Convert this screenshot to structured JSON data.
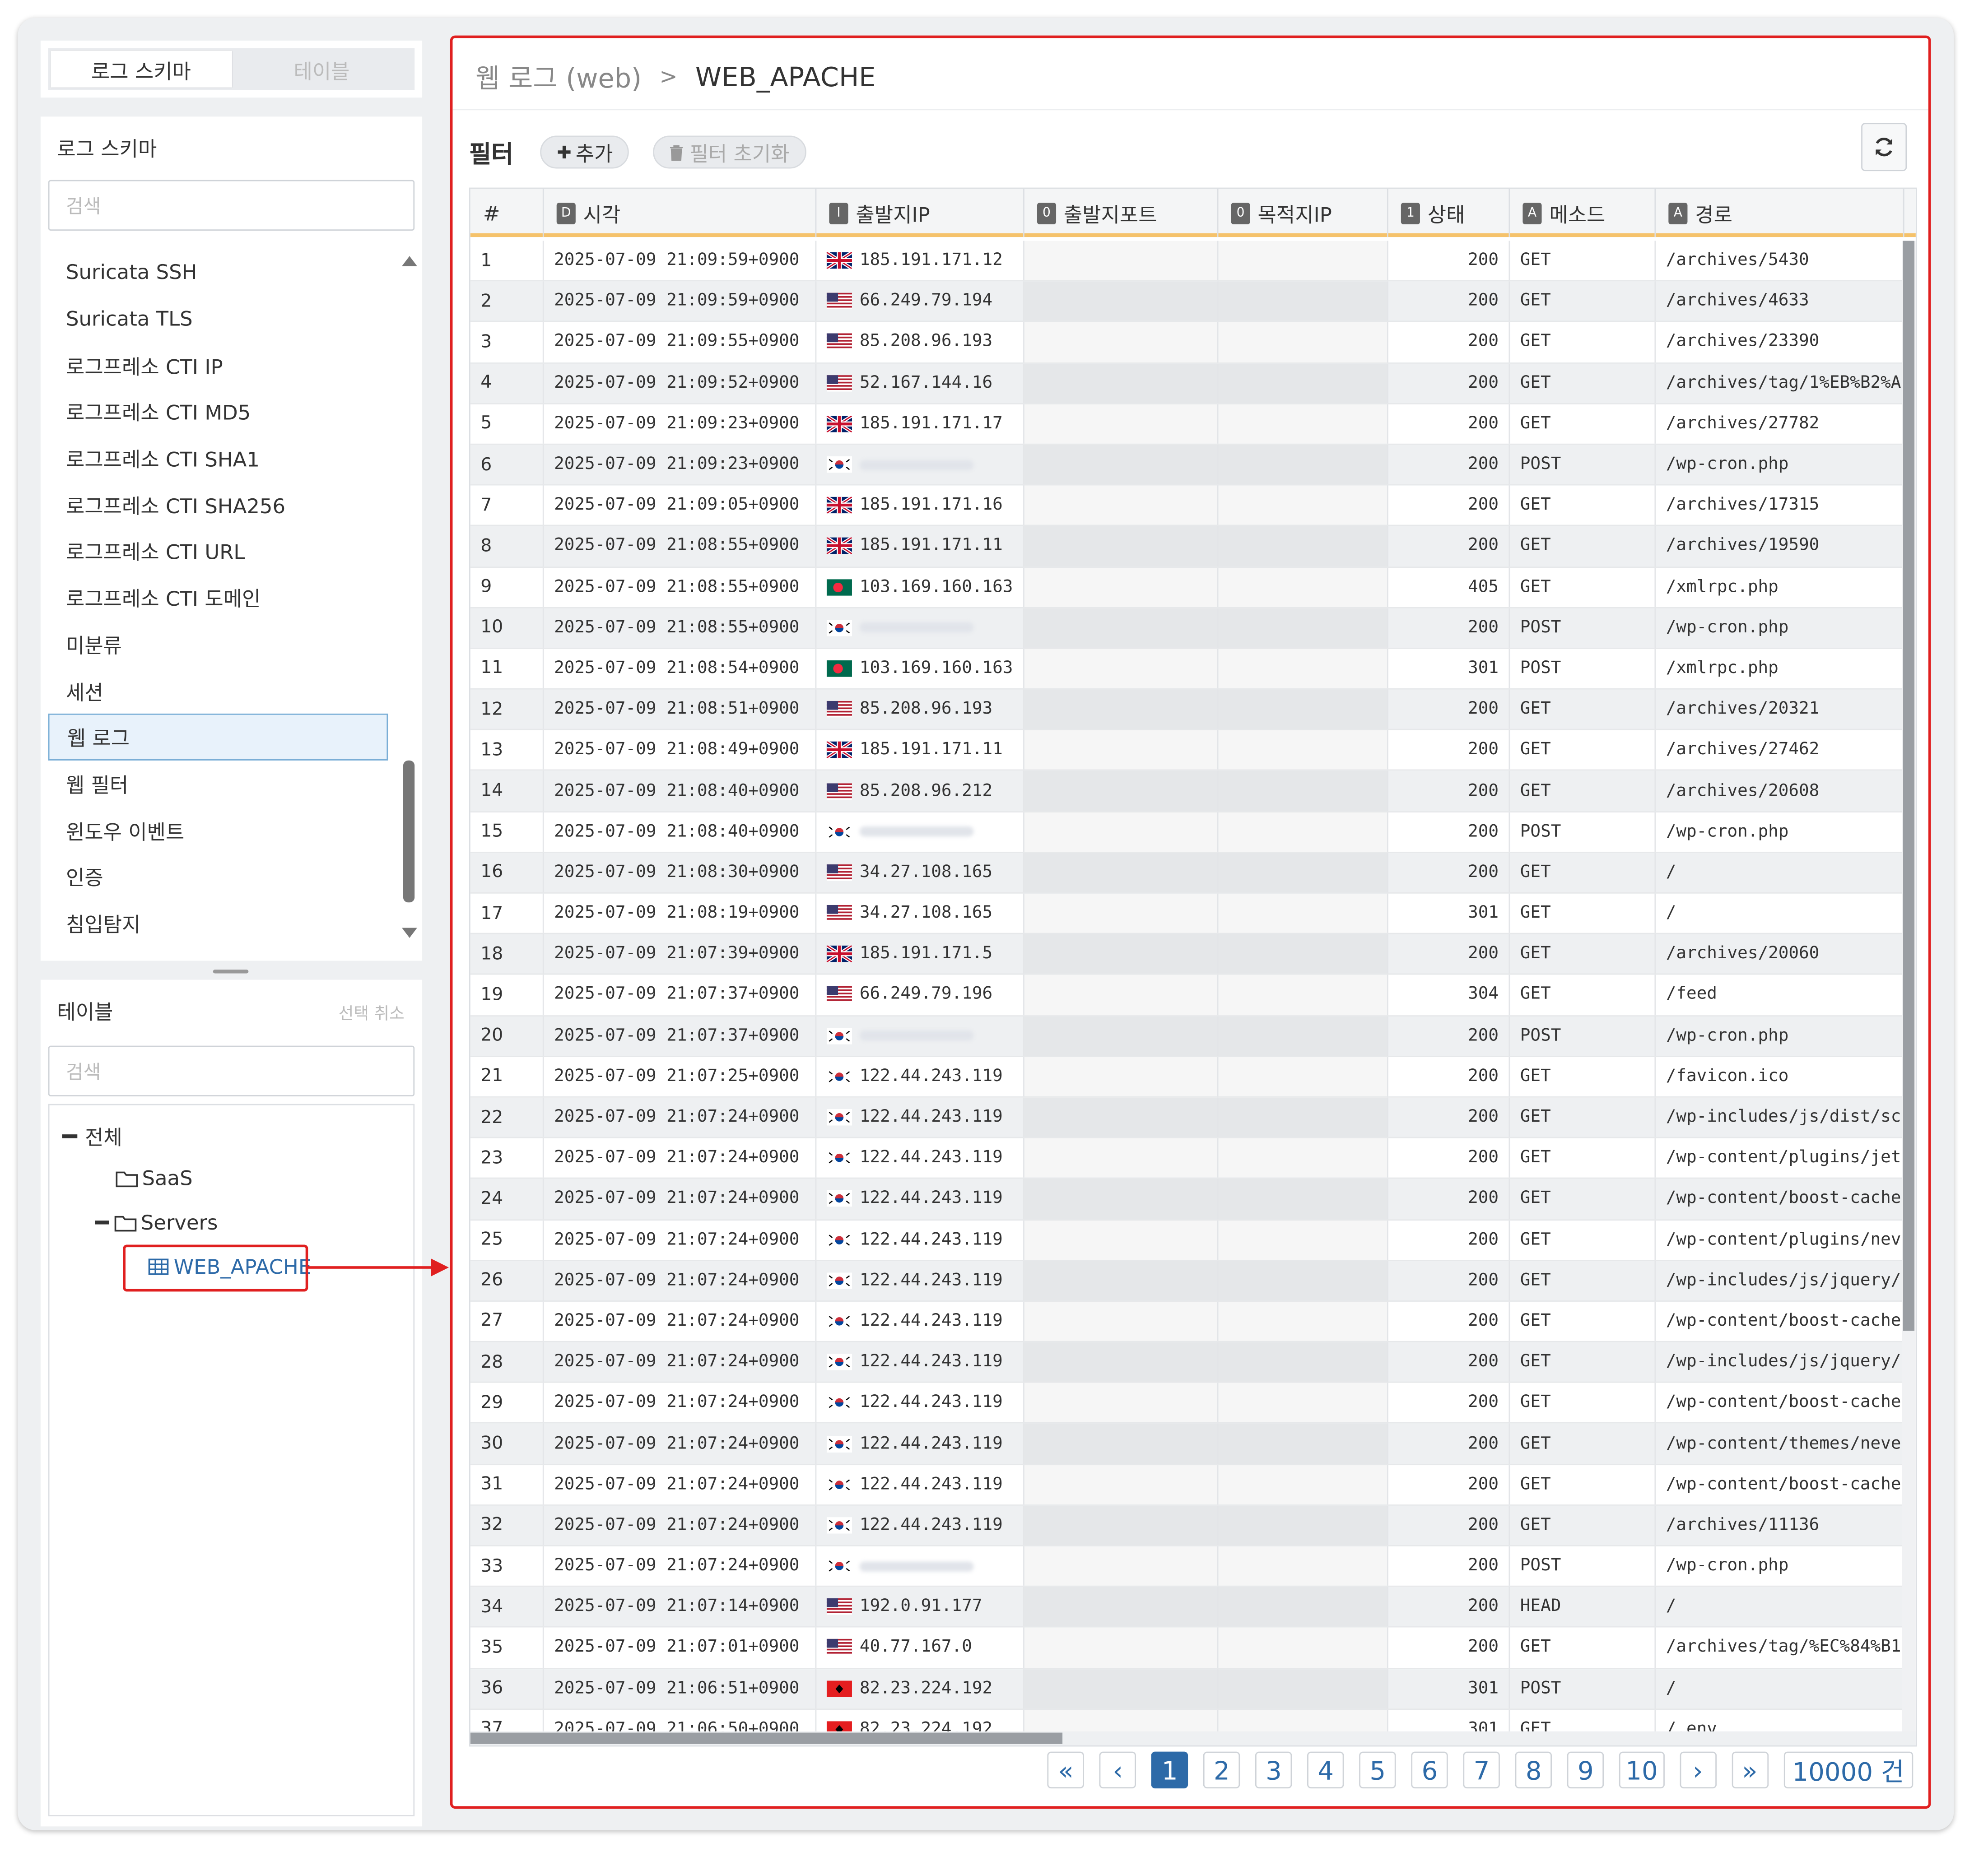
{
  "tabs": {
    "schema": "로그 스키마",
    "table": "테이블"
  },
  "schema_panel": {
    "title": "로그 스키마",
    "search_placeholder": "검색",
    "items": [
      {
        "label": "Suricata SSH"
      },
      {
        "label": "Suricata TLS"
      },
      {
        "label": "로그프레소 CTI IP"
      },
      {
        "label": "로그프레소 CTI MD5"
      },
      {
        "label": "로그프레소 CTI SHA1"
      },
      {
        "label": "로그프레소 CTI SHA256"
      },
      {
        "label": "로그프레소 CTI URL"
      },
      {
        "label": "로그프레소 CTI 도메인"
      },
      {
        "label": "미분류"
      },
      {
        "label": "세션"
      },
      {
        "label": "웹 로그",
        "selected": true
      },
      {
        "label": "웹 필터"
      },
      {
        "label": "윈도우 이벤트"
      },
      {
        "label": "인증"
      },
      {
        "label": "침입탐지"
      }
    ]
  },
  "table_panel": {
    "title": "테이블",
    "deselect": "선택 취소",
    "search_placeholder": "검색",
    "tree": {
      "root": "전체",
      "folder1": "SaaS",
      "folder2": "Servers",
      "table": "WEB_APACHE"
    }
  },
  "main": {
    "breadcrumb": {
      "parent": "웹 로그 (web)",
      "sep": ">",
      "current": "WEB_APACHE"
    },
    "filter_label": "필터",
    "add_label": "추가",
    "reset_label": "필터 초기화",
    "columns": [
      {
        "label": "#",
        "badge": ""
      },
      {
        "label": "시각",
        "badge": "D"
      },
      {
        "label": "출발지IP",
        "badge": "I"
      },
      {
        "label": "출발지포트",
        "badge": "0"
      },
      {
        "label": "목적지IP",
        "badge": "0"
      },
      {
        "label": "상태",
        "badge": "1"
      },
      {
        "label": "메소드",
        "badge": "A"
      },
      {
        "label": "경로",
        "badge": "A"
      }
    ],
    "rows": [
      {
        "n": "1",
        "time": "2025-07-09 21:09:59+0900",
        "flag": "gb",
        "ip": "185.191.171.12",
        "status": "200",
        "method": "GET",
        "path": "/archives/5430"
      },
      {
        "n": "2",
        "time": "2025-07-09 21:09:59+0900",
        "flag": "us",
        "ip": "66.249.79.194",
        "status": "200",
        "method": "GET",
        "path": "/archives/4633"
      },
      {
        "n": "3",
        "time": "2025-07-09 21:09:55+0900",
        "flag": "us",
        "ip": "85.208.96.193",
        "status": "200",
        "method": "GET",
        "path": "/archives/23390"
      },
      {
        "n": "4",
        "time": "2025-07-09 21:09:52+0900",
        "flag": "us",
        "ip": "52.167.144.16",
        "status": "200",
        "method": "GET",
        "path": "/archives/tag/1%EB%B2%A"
      },
      {
        "n": "5",
        "time": "2025-07-09 21:09:23+0900",
        "flag": "gb",
        "ip": "185.191.171.17",
        "status": "200",
        "method": "GET",
        "path": "/archives/27782"
      },
      {
        "n": "6",
        "time": "2025-07-09 21:09:23+0900",
        "flag": "kr",
        "ip": "",
        "status": "200",
        "method": "POST",
        "path": "/wp-cron.php"
      },
      {
        "n": "7",
        "time": "2025-07-09 21:09:05+0900",
        "flag": "gb",
        "ip": "185.191.171.16",
        "status": "200",
        "method": "GET",
        "path": "/archives/17315"
      },
      {
        "n": "8",
        "time": "2025-07-09 21:08:55+0900",
        "flag": "gb",
        "ip": "185.191.171.11",
        "status": "200",
        "method": "GET",
        "path": "/archives/19590"
      },
      {
        "n": "9",
        "time": "2025-07-09 21:08:55+0900",
        "flag": "bd",
        "ip": "103.169.160.163",
        "status": "405",
        "method": "GET",
        "path": "/xmlrpc.php"
      },
      {
        "n": "10",
        "time": "2025-07-09 21:08:55+0900",
        "flag": "kr",
        "ip": "",
        "status": "200",
        "method": "POST",
        "path": "/wp-cron.php"
      },
      {
        "n": "11",
        "time": "2025-07-09 21:08:54+0900",
        "flag": "bd",
        "ip": "103.169.160.163",
        "status": "301",
        "method": "POST",
        "path": "/xmlrpc.php"
      },
      {
        "n": "12",
        "time": "2025-07-09 21:08:51+0900",
        "flag": "us",
        "ip": "85.208.96.193",
        "status": "200",
        "method": "GET",
        "path": "/archives/20321"
      },
      {
        "n": "13",
        "time": "2025-07-09 21:08:49+0900",
        "flag": "gb",
        "ip": "185.191.171.11",
        "status": "200",
        "method": "GET",
        "path": "/archives/27462"
      },
      {
        "n": "14",
        "time": "2025-07-09 21:08:40+0900",
        "flag": "us",
        "ip": "85.208.96.212",
        "status": "200",
        "method": "GET",
        "path": "/archives/20608"
      },
      {
        "n": "15",
        "time": "2025-07-09 21:08:40+0900",
        "flag": "kr",
        "ip": "",
        "status": "200",
        "method": "POST",
        "path": "/wp-cron.php"
      },
      {
        "n": "16",
        "time": "2025-07-09 21:08:30+0900",
        "flag": "us",
        "ip": "34.27.108.165",
        "status": "200",
        "method": "GET",
        "path": "/"
      },
      {
        "n": "17",
        "time": "2025-07-09 21:08:19+0900",
        "flag": "us",
        "ip": "34.27.108.165",
        "status": "301",
        "method": "GET",
        "path": "/"
      },
      {
        "n": "18",
        "time": "2025-07-09 21:07:39+0900",
        "flag": "gb",
        "ip": "185.191.171.5",
        "status": "200",
        "method": "GET",
        "path": "/archives/20060"
      },
      {
        "n": "19",
        "time": "2025-07-09 21:07:37+0900",
        "flag": "us",
        "ip": "66.249.79.196",
        "status": "304",
        "method": "GET",
        "path": "/feed"
      },
      {
        "n": "20",
        "time": "2025-07-09 21:07:37+0900",
        "flag": "kr",
        "ip": "",
        "status": "200",
        "method": "POST",
        "path": "/wp-cron.php"
      },
      {
        "n": "21",
        "time": "2025-07-09 21:07:25+0900",
        "flag": "kr",
        "ip": "122.44.243.119",
        "status": "200",
        "method": "GET",
        "path": "/favicon.ico"
      },
      {
        "n": "22",
        "time": "2025-07-09 21:07:24+0900",
        "flag": "kr",
        "ip": "122.44.243.119",
        "status": "200",
        "method": "GET",
        "path": "/wp-includes/js/dist/sc"
      },
      {
        "n": "23",
        "time": "2025-07-09 21:07:24+0900",
        "flag": "kr",
        "ip": "122.44.243.119",
        "status": "200",
        "method": "GET",
        "path": "/wp-content/plugins/jet"
      },
      {
        "n": "24",
        "time": "2025-07-09 21:07:24+0900",
        "flag": "kr",
        "ip": "122.44.243.119",
        "status": "200",
        "method": "GET",
        "path": "/wp-content/boost-cache"
      },
      {
        "n": "25",
        "time": "2025-07-09 21:07:24+0900",
        "flag": "kr",
        "ip": "122.44.243.119",
        "status": "200",
        "method": "GET",
        "path": "/wp-content/plugins/nev"
      },
      {
        "n": "26",
        "time": "2025-07-09 21:07:24+0900",
        "flag": "kr",
        "ip": "122.44.243.119",
        "status": "200",
        "method": "GET",
        "path": "/wp-includes/js/jquery/"
      },
      {
        "n": "27",
        "time": "2025-07-09 21:07:24+0900",
        "flag": "kr",
        "ip": "122.44.243.119",
        "status": "200",
        "method": "GET",
        "path": "/wp-content/boost-cache"
      },
      {
        "n": "28",
        "time": "2025-07-09 21:07:24+0900",
        "flag": "kr",
        "ip": "122.44.243.119",
        "status": "200",
        "method": "GET",
        "path": "/wp-includes/js/jquery/"
      },
      {
        "n": "29",
        "time": "2025-07-09 21:07:24+0900",
        "flag": "kr",
        "ip": "122.44.243.119",
        "status": "200",
        "method": "GET",
        "path": "/wp-content/boost-cache"
      },
      {
        "n": "30",
        "time": "2025-07-09 21:07:24+0900",
        "flag": "kr",
        "ip": "122.44.243.119",
        "status": "200",
        "method": "GET",
        "path": "/wp-content/themes/neve"
      },
      {
        "n": "31",
        "time": "2025-07-09 21:07:24+0900",
        "flag": "kr",
        "ip": "122.44.243.119",
        "status": "200",
        "method": "GET",
        "path": "/wp-content/boost-cache"
      },
      {
        "n": "32",
        "time": "2025-07-09 21:07:24+0900",
        "flag": "kr",
        "ip": "122.44.243.119",
        "status": "200",
        "method": "GET",
        "path": "/archives/11136"
      },
      {
        "n": "33",
        "time": "2025-07-09 21:07:24+0900",
        "flag": "kr",
        "ip": "",
        "status": "200",
        "method": "POST",
        "path": "/wp-cron.php"
      },
      {
        "n": "34",
        "time": "2025-07-09 21:07:14+0900",
        "flag": "us",
        "ip": "192.0.91.177",
        "status": "200",
        "method": "HEAD",
        "path": "/"
      },
      {
        "n": "35",
        "time": "2025-07-09 21:07:01+0900",
        "flag": "us",
        "ip": "40.77.167.0",
        "status": "200",
        "method": "GET",
        "path": "/archives/tag/%EC%84%B1"
      },
      {
        "n": "36",
        "time": "2025-07-09 21:06:51+0900",
        "flag": "al",
        "ip": "82.23.224.192",
        "status": "301",
        "method": "POST",
        "path": "/"
      },
      {
        "n": "37",
        "time": "2025-07-09 21:06:50+0900",
        "flag": "al",
        "ip": "82.23.224.192",
        "status": "301",
        "method": "GET",
        "path": "/.env"
      }
    ],
    "pagination": {
      "first": "«",
      "prev": "‹",
      "next": "›",
      "last": "»",
      "pages": [
        "1",
        "2",
        "3",
        "4",
        "5",
        "6",
        "7",
        "8",
        "9",
        "10"
      ],
      "current": "1",
      "total": "10000 건"
    }
  },
  "colors": {
    "accent": "#2d6aa8",
    "highlight": "#e02020",
    "header_rule": "#f5c26b"
  }
}
